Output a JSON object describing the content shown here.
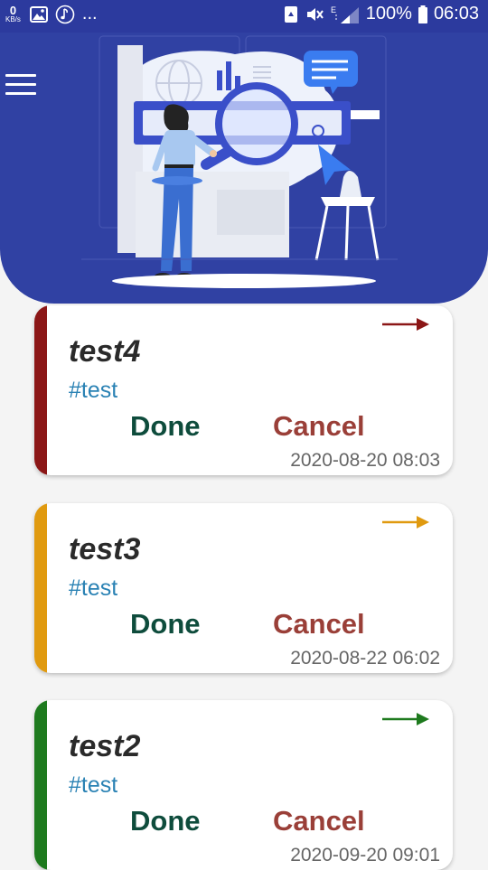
{
  "status_bar": {
    "speed_value": "0",
    "speed_unit": "KB/s",
    "more": "...",
    "battery": "100%",
    "time": "06:03",
    "icons": [
      "image-icon",
      "music-icon",
      "recycle-icon",
      "mute-icon",
      "signal-icon",
      "battery-icon"
    ]
  },
  "header": {
    "menu_icon": "hamburger-menu-icon",
    "illustration": "search-illustration",
    "background_color": "#3041a3"
  },
  "tasks": [
    {
      "title": "test4",
      "tag": "#test",
      "done_label": "Done",
      "cancel_label": "Cancel",
      "date": "2020-08-20 08:03",
      "color": "#8b1616"
    },
    {
      "title": "test3",
      "tag": "#test",
      "done_label": "Done",
      "cancel_label": "Cancel",
      "date": "2020-08-22 06:02",
      "color": "#e09a10"
    },
    {
      "title": "test2",
      "tag": "#test",
      "done_label": "Done",
      "cancel_label": "Cancel",
      "date": "2020-09-20 09:01",
      "color": "#1e7a1e"
    }
  ]
}
